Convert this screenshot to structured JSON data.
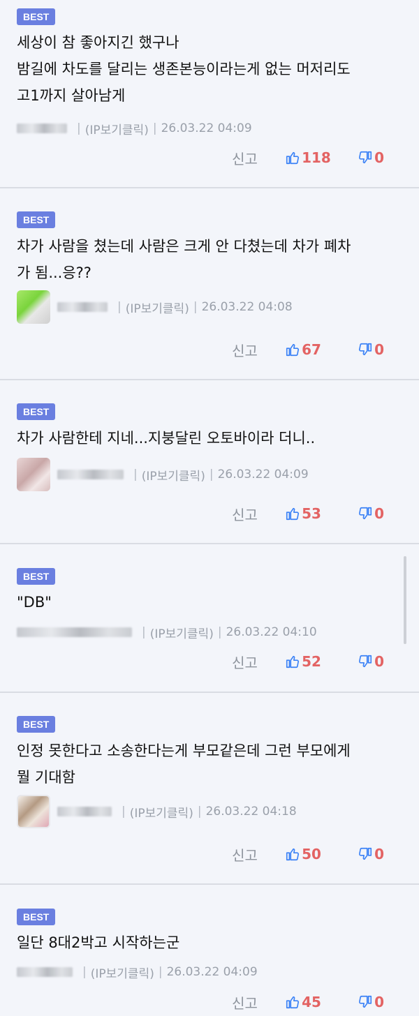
{
  "comments": [
    {
      "badge": "BEST",
      "text": "세상이 참 좋아지긴 했구나\n밤길에 차도를 달리는 생존본능이라는게 없는 머저리도\n고1까지 살아남게",
      "ip": "(IP보기클릭)",
      "date": "26.03.22 04:09",
      "report": "신고",
      "likes": "118",
      "dislikes": "0"
    },
    {
      "badge": "BEST",
      "text": "차가 사람을 쳤는데 사람은 크게 안 다쳤는데 차가 폐차\n가 됨...응??",
      "ip": "(IP보기클릭)",
      "date": "26.03.22 04:08",
      "report": "신고",
      "likes": "67",
      "dislikes": "0"
    },
    {
      "badge": "BEST",
      "text": "차가 사람한테 지네...지붕달린 오토바이라 더니..",
      "ip": "(IP보기클릭)",
      "date": "26.03.22 04:09",
      "report": "신고",
      "likes": "53",
      "dislikes": "0"
    },
    {
      "badge": "BEST",
      "text": "\"DB\"",
      "ip": "(IP보기클릭)",
      "date": "26.03.22 04:10",
      "report": "신고",
      "likes": "52",
      "dislikes": "0"
    },
    {
      "badge": "BEST",
      "text": "인정 못한다고 소송한다는게 부모같은데 그런 부모에게\n뭘 기대함",
      "ip": "(IP보기클릭)",
      "date": "26.03.22 04:18",
      "report": "신고",
      "likes": "50",
      "dislikes": "0"
    },
    {
      "badge": "BEST",
      "text": "일단 8대2박고 시작하는군",
      "ip": "(IP보기클릭)",
      "date": "26.03.22 04:09",
      "report": "신고",
      "likes": "45",
      "dislikes": "0"
    }
  ],
  "colors": {
    "badge": "#6a7fe0",
    "count": "#e36363",
    "thumb_icon": "#3b82f6",
    "background": "#f3f5fa"
  },
  "icons": {
    "like": "thumbs-up-icon",
    "dislike": "thumbs-down-icon"
  }
}
